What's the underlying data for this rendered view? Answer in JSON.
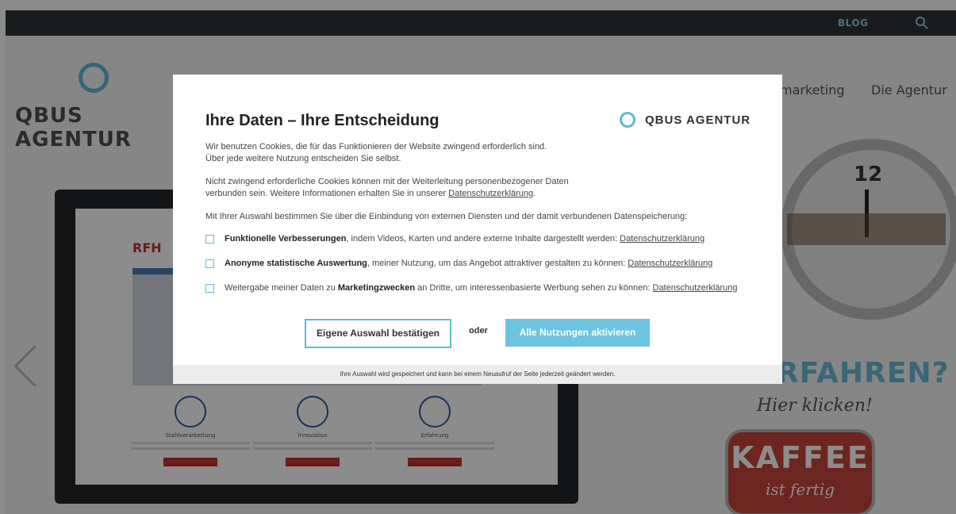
{
  "site": {
    "topbar": {
      "blog_label": "BLOG",
      "search_icon": "search-icon"
    },
    "logo_text": "QBUS AGENTUR",
    "nav": [
      "marketing",
      "Die Agentur"
    ],
    "monitor": {
      "brand": "RFH",
      "features": [
        {
          "title": "Stahlverarbeitung"
        },
        {
          "title": "Innovation"
        },
        {
          "title": "Erfahrung"
        }
      ]
    },
    "promo": {
      "headline": "RFAHREN?",
      "hier": "Hier klicken!",
      "kaffee": "KAFFEE",
      "kaffee_sub": "ist fertig"
    },
    "clock_number": "12"
  },
  "modal": {
    "title": "Ihre Daten – Ihre Entscheidung",
    "brand": "QBUS AGENTUR",
    "intro_line1": "Wir benutzen Cookies, die für das Funktionieren der Website zwingend erforderlich sind.",
    "intro_line2": "Über jede weitere Nutzung entscheiden Sie selbst.",
    "notice_line1": "Nicht zwingend erforderliche Cookies können mit der Weiterleitung personenbezogener Daten",
    "notice_line2_prefix": "verbunden sein. Weitere Informationen erhalten Sie in unserer ",
    "notice_link": "Datenschutzerklärung",
    "notice_suffix": ".",
    "choice_text": "Mit Ihrer Auswahl bestimmen Sie über die Einbindung von externen Diensten und der damit verbundenen Datenspeicherung:",
    "options": [
      {
        "bold": "Funktionelle Verbesserungen",
        "text": ", indem Videos, Karten und andere externe Inhalte dargestellt werden: ",
        "link": "Datenschutzerklärung",
        "checked": false
      },
      {
        "bold": "Anonyme statistische Auswertung",
        "text": ", meiner Nutzung, um das Angebot attraktiver gestalten zu können: ",
        "link": "Datenschutzerklärung",
        "checked": false
      },
      {
        "prefix": "Weitergabe meiner Daten zu ",
        "bold": "Marketingzwecken",
        "text": " an Dritte, um interessenbasierte Werbung sehen zu können: ",
        "link": "Datenschutzerklärung",
        "checked": false
      }
    ],
    "confirm_button": "Eigene Auswahl bestätigen",
    "or_label": "oder",
    "all_button": "Alle Nutzungen aktivieren",
    "footer_text": "Ihre Auswahl wird gespeichert und kann bei einem Neuaufruf der Seite jederzeit geändert werden."
  },
  "colors": {
    "accent": "#6cc4e0",
    "topbar": "#2e3335",
    "kaffee": "#c5443a"
  }
}
